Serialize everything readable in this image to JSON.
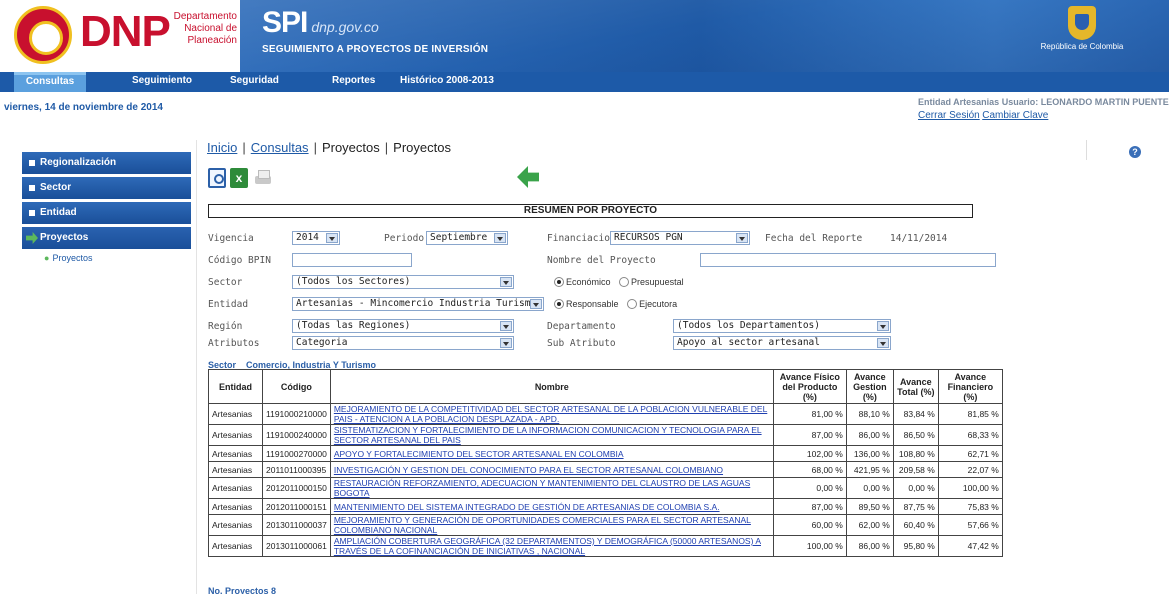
{
  "header": {
    "logo_text": "DNP",
    "logo_subtitle": "Departamento Nacional de Planeación",
    "app_name": "SPI",
    "app_site": "dnp.gov.co",
    "app_subtitle": "SEGUIMIENTO A PROYECTOS DE INVERSIÓN",
    "coat_caption": "República de Colombia"
  },
  "nav": {
    "tabs": [
      {
        "label": "Consultas",
        "active": true
      },
      {
        "label": "Seguimiento"
      },
      {
        "label": "Seguridad"
      },
      {
        "label": "Reportes"
      },
      {
        "label": "Histórico 2008-2013"
      }
    ]
  },
  "date_text": "viernes, 14 de noviembre de 2014",
  "user": {
    "line": "Entidad Artesanias Usuario: LEONARDO MARTIN PUENTES",
    "logout": "Cerrar Sesión",
    "change_password": "Cambiar Clave"
  },
  "sidebar": {
    "items": [
      {
        "label": "Regionalización"
      },
      {
        "label": "Sector"
      },
      {
        "label": "Entidad"
      },
      {
        "label": "Proyectos",
        "active": true
      }
    ],
    "subitem": "Proyectos"
  },
  "breadcrumb": {
    "inicio": "Inicio",
    "consultas": "Consultas",
    "proyectos1": "Proyectos",
    "proyectos2": "Proyectos"
  },
  "report_title": "RESUMEN POR PROYECTO",
  "form": {
    "vigencia_label": "Vigencia",
    "vigencia_value": "2014",
    "periodo_label": "Periodo",
    "periodo_value": "Septiembre",
    "financiacion_label": "Financiacion",
    "financiacion_value": "RECURSOS PGN",
    "fecha_label": "Fecha del Reporte",
    "fecha_value": "14/11/2014",
    "bpin_label": "Código BPIN",
    "bpin_value": "",
    "nombre_label": "Nombre del Proyecto",
    "nombre_value": "",
    "sector_label": "Sector",
    "sector_value": "(Todos los Sectores)",
    "radio1": {
      "a": "Económico",
      "b": "Presupuestal"
    },
    "entidad_label": "Entidad",
    "entidad_value": "Artesanias - Mincomercio Industria Turismo - Ar",
    "radio2": {
      "a": "Responsable",
      "b": "Ejecutora"
    },
    "region_label": "Región",
    "region_value": "(Todas las Regiones)",
    "departamento_label": "Departamento",
    "departamento_value": "(Todos los Departamentos)",
    "atributos_label": "Atributos",
    "atributos_value": "Categoria",
    "subatributo_label": "Sub Atributo",
    "subatributo_value": "Apoyo al sector artesanal"
  },
  "sector_line": {
    "label": "Sector",
    "value": "Comercio, Industria Y Turismo"
  },
  "table": {
    "headers": {
      "entidad": "Entidad",
      "codigo": "Código",
      "nombre": "Nombre",
      "fisico": "Avance Físico del Producto (%)",
      "gestion": "Avance Gestion (%)",
      "total": "Avance Total (%)",
      "financiero": "Avance Financiero (%)"
    },
    "rows": [
      {
        "entidad": "Artesanias",
        "codigo": "1191000210000",
        "nombre": "MEJORAMIENTO DE LA COMPETITIVIDAD DEL SECTOR ARTESANAL DE LA POBLACION VULNERABLE DEL PAIS - ATENCION A LA POBLACION DESPLAZADA - APD.",
        "fisico": "81,00 %",
        "gestion": "88,10 %",
        "total": "83,84 %",
        "financiero": "81,85 %"
      },
      {
        "entidad": "Artesanias",
        "codigo": "1191000240000",
        "nombre": "SISTEMATIZACION Y FORTALECIMIENTO DE LA INFORMACION COMUNICACION Y TECNOLOGIA PARA EL SECTOR ARTESANAL DEL PAIS",
        "fisico": "87,00 %",
        "gestion": "86,00 %",
        "total": "86,50 %",
        "financiero": "68,33 %"
      },
      {
        "entidad": "Artesanias",
        "codigo": "1191000270000",
        "nombre": "APOYO Y FORTALECIMIENTO DEL SECTOR ARTESANAL EN COLOMBIA",
        "fisico": "102,00 %",
        "gestion": "136,00 %",
        "total": "108,80 %",
        "financiero": "62,71 %"
      },
      {
        "entidad": "Artesanias",
        "codigo": "2011011000395",
        "nombre": "INVESTIGACIÓN Y GESTION DEL CONOCIMIENTO PARA EL SECTOR ARTESANAL COLOMBIANO",
        "fisico": "68,00 %",
        "gestion": "421,95 %",
        "total": "209,58 %",
        "financiero": "22,07 %"
      },
      {
        "entidad": "Artesanias",
        "codigo": "2012011000150",
        "nombre": "RESTAURACIÓN REFORZAMIENTO, ADECUACION Y MANTENIMIENTO DEL CLAUSTRO DE LAS AGUAS BOGOTA",
        "fisico": "0,00 %",
        "gestion": "0,00 %",
        "total": "0,00 %",
        "financiero": "100,00 %"
      },
      {
        "entidad": "Artesanias",
        "codigo": "2012011000151",
        "nombre": "MANTENIMIENTO DEL SISTEMA INTEGRADO DE GESTIÓN DE ARTESANIAS DE COLOMBIA S.A.",
        "fisico": "87,00 %",
        "gestion": "89,50 %",
        "total": "87,75 %",
        "financiero": "75,83 %"
      },
      {
        "entidad": "Artesanias",
        "codigo": "2013011000037",
        "nombre": "MEJORAMIENTO Y GENERACIÓN DE OPORTUNIDADES COMERCIALES PARA EL SECTOR ARTESANAL COLOMBIANO NACIONAL",
        "fisico": "60,00 %",
        "gestion": "62,00 %",
        "total": "60,40 %",
        "financiero": "57,66 %"
      },
      {
        "entidad": "Artesanias",
        "codigo": "2013011000061",
        "nombre": "AMPLIACIÓN COBERTURA GEOGRÁFICA (32 DEPARTAMENTOS) Y DEMOGRÁFICA (50000 ARTESANOS) A TRAVÉS DE LA COFINANCIACIÓN DE INICIATIVAS , NACIONAL",
        "fisico": "100,00 %",
        "gestion": "86,00 %",
        "total": "95,80 %",
        "financiero": "47,42 %"
      }
    ]
  },
  "no_proyectos": "No. Proyectos 8",
  "colors": {
    "brand_red": "#c8102e",
    "nav_blue": "#1d5aa8",
    "link_blue": "#1f3fb0"
  }
}
